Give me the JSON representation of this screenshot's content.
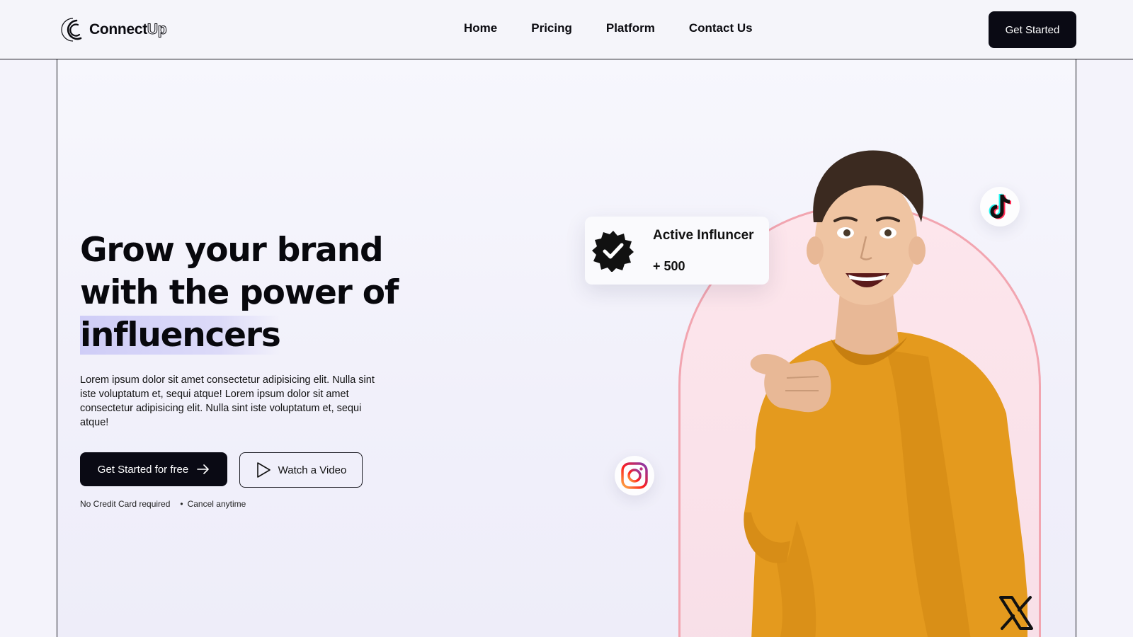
{
  "header": {
    "brand_bold": "Connect",
    "brand_outline": "Up",
    "nav": [
      {
        "label": "Home"
      },
      {
        "label": "Pricing"
      },
      {
        "label": "Platform"
      },
      {
        "label": "Contact Us"
      }
    ],
    "cta_label": "Get Started"
  },
  "hero": {
    "title_line1": "Grow your brand",
    "title_line2": "with the power of",
    "title_highlight": "influencers",
    "description": "Lorem ipsum dolor sit amet consectetur adipisicing elit. Nulla sint iste voluptatum et, sequi atque! Lorem ipsum dolor sit amet consectetur adipisicing elit. Nulla sint iste voluptatum et, sequi atque!",
    "primary_cta": "Get Started for free",
    "secondary_cta": "Watch a Video",
    "fineprint": [
      "No Credit Card required",
      "Cancel anytime"
    ]
  },
  "influencer_card": {
    "title": "Active Influncer",
    "count": "+ 500"
  },
  "icons": {
    "logo": "connectup-logo-icon",
    "arrow": "arrow-right-icon",
    "play": "play-icon",
    "verified": "verified-badge-icon",
    "tiktok": "tiktok-icon",
    "instagram": "instagram-icon",
    "x": "x-logo-icon"
  },
  "colors": {
    "dark": "#0a0a14",
    "highlight": "#cfcdf7",
    "arch_border": "#f2a5b0",
    "sweater": "#e49a1e"
  }
}
